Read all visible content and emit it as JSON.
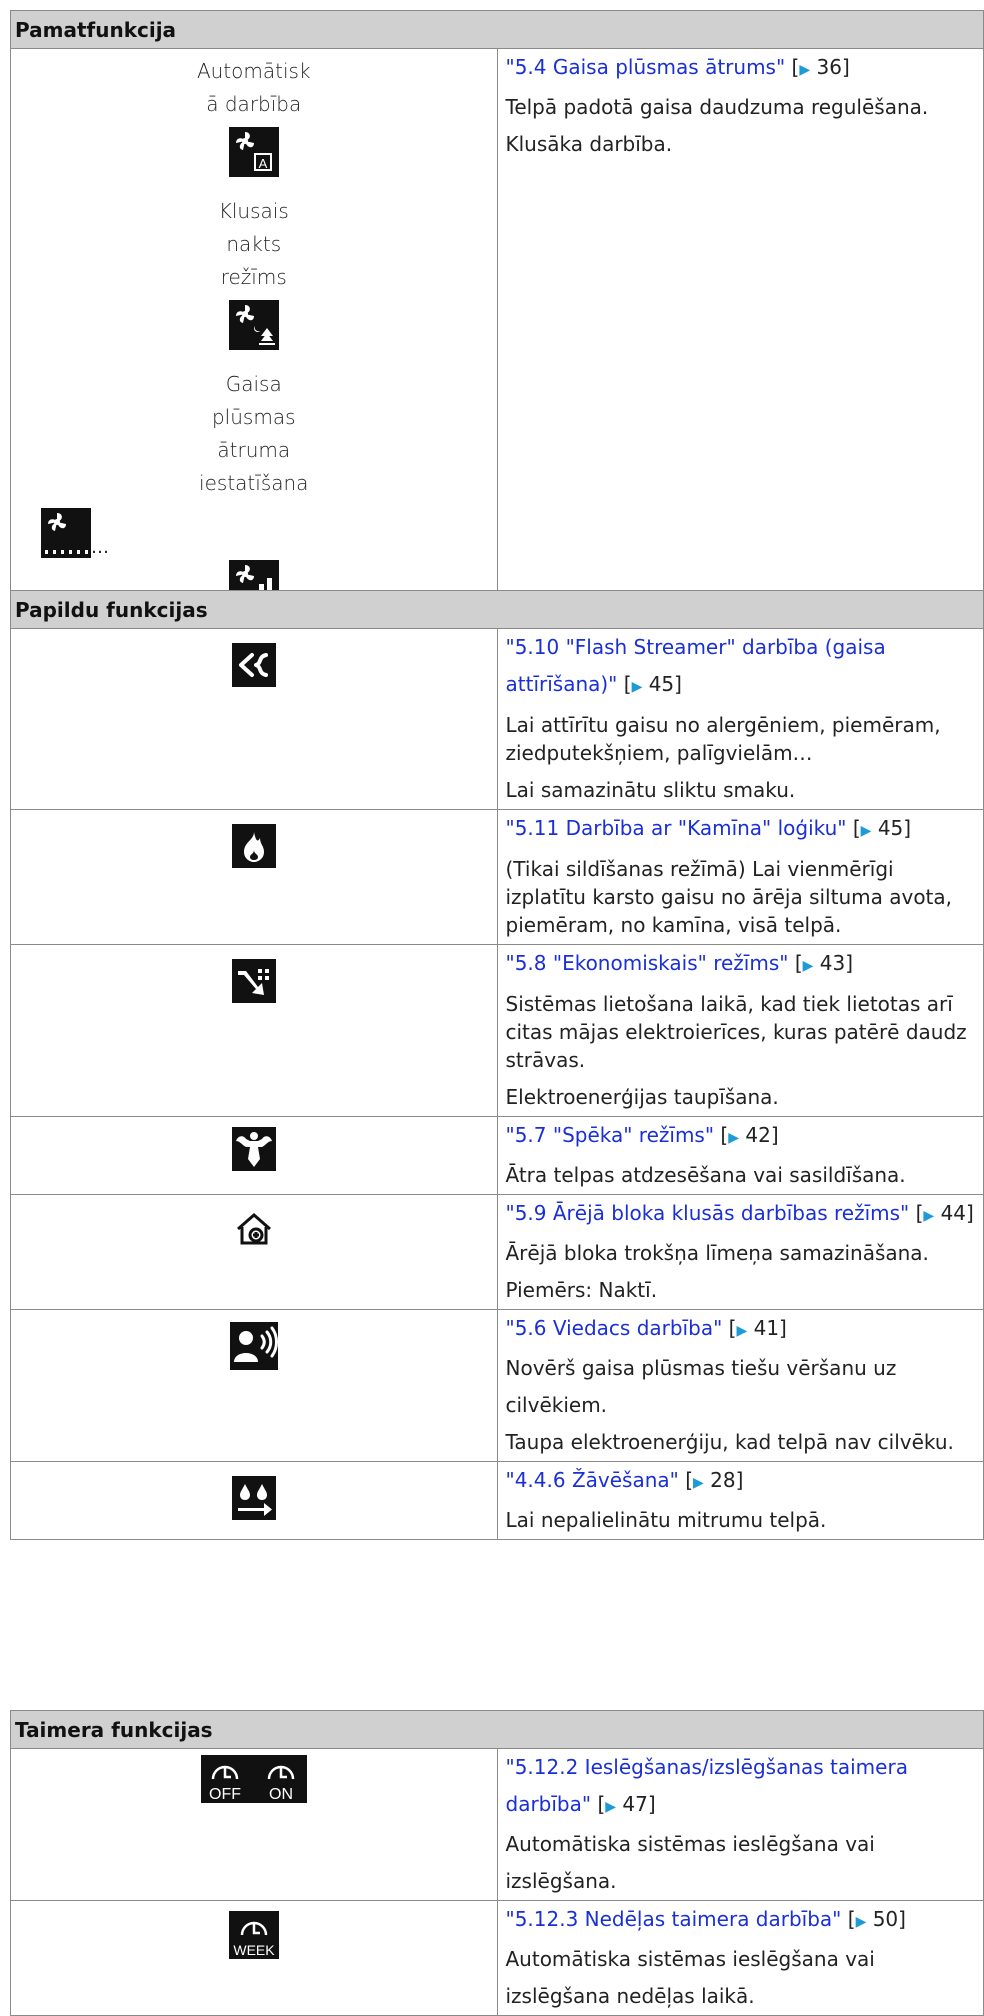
{
  "sections": [
    {
      "header": "Pamatfunkcija",
      "rows": [
        {
          "left_labels": [
            "Automātisk ā darbība",
            "Klusais nakts režīms",
            "Gaisa plūsmas ātruma iestatīšana"
          ],
          "link": "\"5.4 Gaisa plūsmas ātrums\"",
          "page": "36",
          "lines": [
            "Telpā padotā gaisa daudzuma regulēšana.",
            "Klusāka darbība."
          ]
        }
      ]
    },
    {
      "header": "Papildu funkcijas",
      "rows": [
        {
          "icon": "flash-streamer-icon",
          "link": "\"5.10 \"Flash Streamer\" darbība (gaisa attīrīšana)\"",
          "page": "45",
          "lines": [
            "Lai attīrītu gaisu no alergēniem, piemēram, ziedputekšņiem, palīgvielām…",
            "Lai samazinātu sliktu smaku."
          ]
        },
        {
          "icon": "fireplace-flame-icon",
          "link": "\"5.11 Darbība ar \"Kamīna\" loģiku\"",
          "page": "45",
          "lines": [
            "(Tikai sildīšanas režīmā) Lai vienmērīgi izplatītu karsto gaisu no ārēja siltuma avota, piemēram, no kamīna, visā telpā."
          ]
        },
        {
          "icon": "econo-mode-icon",
          "link": "\"5.8 \"Ekonomiskais\" režīms\"",
          "page": "43",
          "lines": [
            "Sistēmas lietošana laikā, kad tiek lietotas arī citas mājas elektroierīces, kuras patērē daudz strāvas.",
            "Elektroenerģijas taupīšana."
          ]
        },
        {
          "icon": "powerful-mode-icon",
          "link": "\"5.7 \"Spēka\" režīms\"",
          "page": "42",
          "lines": [
            "Ātra telpas atdzesēšana vai sasildīšana."
          ]
        },
        {
          "icon": "outdoor-quiet-icon",
          "link": "\"5.9 Ārējā bloka klusās darbības režīms\"",
          "page": "44",
          "lines": [
            "Ārējā bloka trokšņa līmeņa samazināšana. Piemērs: Naktī."
          ]
        },
        {
          "icon": "intelligent-eye-icon",
          "link": "\"5.6 Viedacs darbība\"",
          "page": "41",
          "lines": [
            "Novērš gaisa plūsmas tiešu vēršanu uz cilvēkiem.",
            "Taupa elektroenerģiju, kad telpā nav cilvēku."
          ]
        },
        {
          "icon": "dry-mode-icon",
          "link": "\"4.4.6 Žāvēšana\"",
          "page": "28",
          "lines": [
            "Lai nepalielinātu mitrumu telpā."
          ]
        }
      ]
    },
    {
      "header": "Taimera funkcijas",
      "rows": [
        {
          "icon": "on-off-timer-icon",
          "icon_text": [
            "OFF",
            "ON"
          ],
          "link": "\"5.12.2 Ieslēgšanas/izslēgšanas taimera darbība\"",
          "page": "47",
          "lines": [
            "Automātiska sistēmas ieslēgšana vai izslēgšana."
          ]
        },
        {
          "icon": "week-timer-icon",
          "icon_text": [
            "WEEK"
          ],
          "link": "\"5.12.3 Nedēļas taimera darbība\"",
          "page": "50",
          "lines": [
            "Automātiska sistēmas ieslēgšana vai izslēgšana nedēļas laikā."
          ]
        }
      ]
    }
  ],
  "symbols": {
    "open_bracket": "[",
    "close_bracket": "]",
    "arrow": "▶",
    "ellipsis": "…"
  }
}
